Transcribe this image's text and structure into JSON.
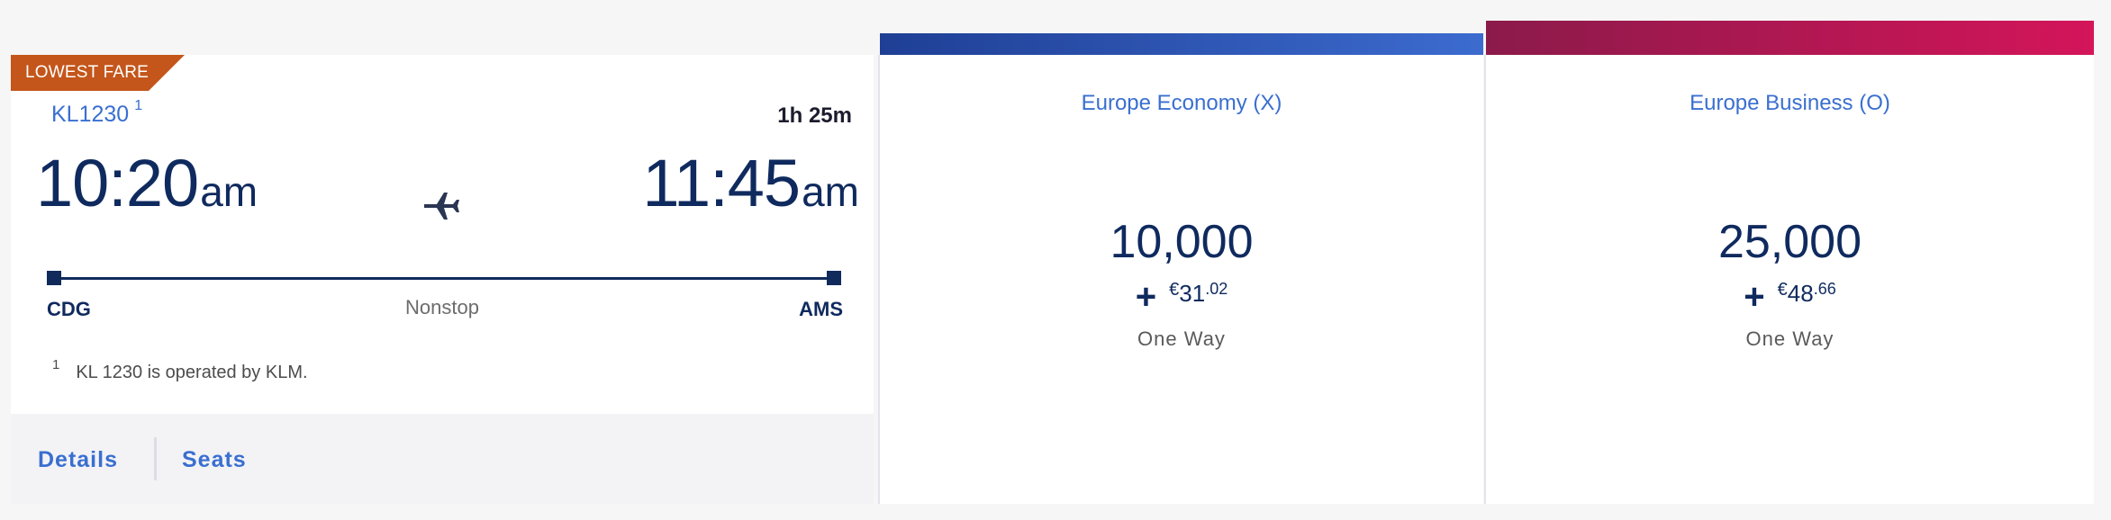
{
  "flight": {
    "badge": "LOWEST FARE",
    "flight_number": "KL1230",
    "flight_footnote_ref": "1",
    "duration": "1h 25m",
    "departure": {
      "time": "10:20",
      "ampm": "am",
      "airport": "CDG"
    },
    "arrival": {
      "time": "11:45",
      "ampm": "am",
      "airport": "AMS"
    },
    "stops": "Nonstop",
    "footnote": {
      "num": "1",
      "text": "KL 1230 is operated by KLM."
    },
    "actions": {
      "details": "Details",
      "seats": "Seats"
    },
    "icons": [
      "plane-icon"
    ]
  },
  "fares": {
    "economy": {
      "name": "Europe Economy (X)",
      "miles": "10,000",
      "plus": "+",
      "currency": "€",
      "amount_whole": "31",
      "amount_cents": ".02",
      "trip": "One Way",
      "bar_color": "#2a52b8"
    },
    "business": {
      "name": "Europe Business (O)",
      "miles": "25,000",
      "plus": "+",
      "currency": "€",
      "amount_whole": "48",
      "amount_cents": ".66",
      "trip": "One Way",
      "bar_color": "#c0195a"
    }
  },
  "colors": {
    "accent_blue": "#3a6fd0",
    "navy": "#0f2a5e",
    "badge": "#c4561b"
  }
}
